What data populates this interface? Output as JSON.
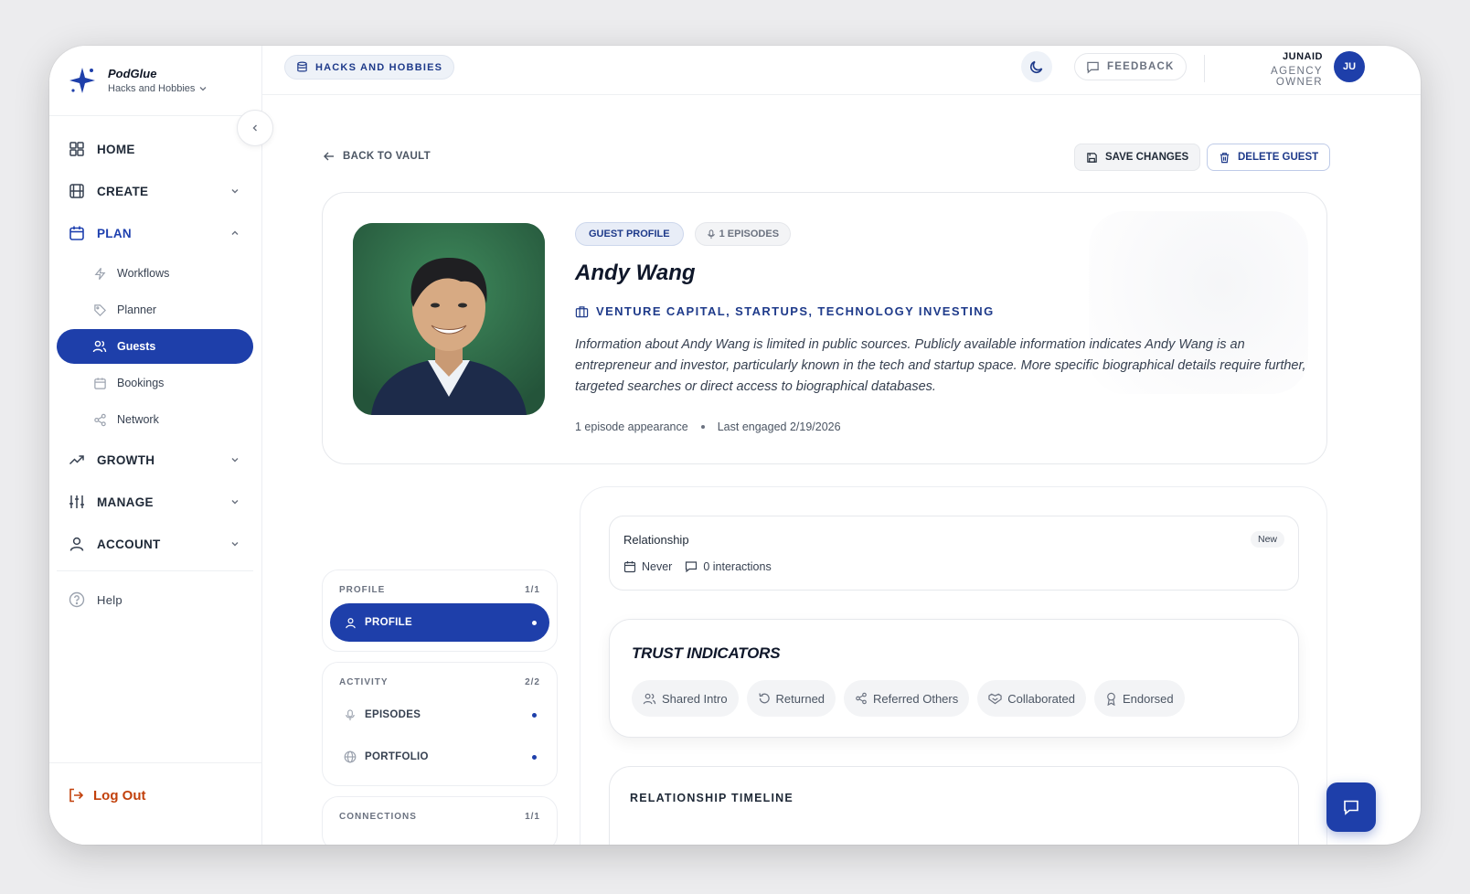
{
  "brand": {
    "name": "PodGlue",
    "workspace": "Hacks and Hobbies",
    "accent": "#1e3faa"
  },
  "sidebar": {
    "items": [
      {
        "label": "HOME",
        "icon": "home-grid-icon"
      },
      {
        "label": "CREATE",
        "icon": "film-icon"
      },
      {
        "label": "PLAN",
        "icon": "calendar-icon"
      },
      {
        "label": "GROWTH",
        "icon": "trending-up-icon"
      },
      {
        "label": "MANAGE",
        "icon": "sliders-icon"
      },
      {
        "label": "ACCOUNT",
        "icon": "user-icon"
      }
    ],
    "plan_sub": [
      {
        "label": "Workflows",
        "icon": "bolt-icon"
      },
      {
        "label": "Planner",
        "icon": "tag-icon"
      },
      {
        "label": "Guests",
        "icon": "users-icon"
      },
      {
        "label": "Bookings",
        "icon": "calendar-small-icon"
      },
      {
        "label": "Network",
        "icon": "share-icon"
      }
    ],
    "help": "Help",
    "logout": "Log Out"
  },
  "topbar": {
    "workspace_pill": "HACKS AND HOBBIES",
    "feedback": "FEEDBACK",
    "user_name": "JUNAID",
    "user_role": "AGENCY OWNER",
    "avatar_initials": "JU"
  },
  "actions": {
    "back": "BACK TO VAULT",
    "save": "SAVE CHANGES",
    "delete": "DELETE GUEST"
  },
  "guest": {
    "badge_profile": "GUEST PROFILE",
    "badge_episodes": "1 EPISODES",
    "name": "Andy Wang",
    "industry": "VENTURE CAPITAL, STARTUPS, TECHNOLOGY INVESTING",
    "bio": "Information about Andy Wang is limited in public sources. Publicly available information indicates Andy Wang is an entrepreneur and investor, particularly known in the tech and startup space. More specific biographical details require further, targeted searches or direct access to biographical databases.",
    "appearances": "1 episode appearance",
    "last_engaged": "Last engaged 2/19/2026"
  },
  "sections": {
    "profile": {
      "head": "PROFILE",
      "count": "1/1",
      "items": [
        "PROFILE"
      ]
    },
    "activity": {
      "head": "ACTIVITY",
      "count": "2/2",
      "items": [
        "EPISODES",
        "PORTFOLIO"
      ]
    },
    "connections": {
      "head": "CONNECTIONS",
      "count": "1/1"
    }
  },
  "relationship": {
    "title": "Relationship",
    "badge": "New",
    "last": "Never",
    "interactions": "0 interactions"
  },
  "trust": {
    "title": "TRUST INDICATORS",
    "chips": [
      "Shared Intro",
      "Returned",
      "Referred Others",
      "Collaborated",
      "Endorsed"
    ]
  },
  "timeline": {
    "title": "RELATIONSHIP TIMELINE"
  }
}
